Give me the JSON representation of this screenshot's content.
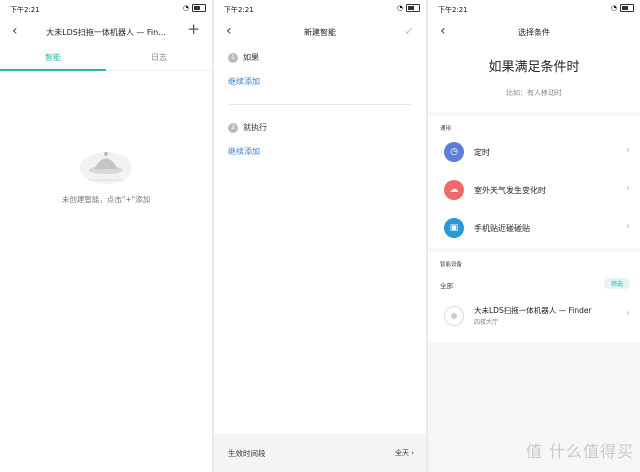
{
  "status": {
    "time": "下午2:21"
  },
  "screen1": {
    "title": "大未LDS扫拖一体机器人 — Fin...",
    "add_icon": "plus-icon",
    "tabs": [
      "智能",
      "日志"
    ],
    "empty_text": "未创建智能，点击\"+\"添加"
  },
  "screen2": {
    "title": "新建智能",
    "if_number": "1",
    "if_label": "如果",
    "if_add": "继续添加",
    "then_number": "2",
    "then_label": "就执行",
    "then_add": "继续添加",
    "footer_label": "生效时间段",
    "footer_value": "全天"
  },
  "screen3": {
    "title": "选择条件",
    "big_title": "如果满足条件时",
    "hint": "比如：有人移动时",
    "general_label": "通用",
    "general_items": [
      {
        "label": "定时",
        "icon": "clock-icon",
        "color": "#5b7fd9"
      },
      {
        "label": "室外天气发生变化时",
        "icon": "weather-icon",
        "color": "#ef6a6a"
      },
      {
        "label": "手机贴近碰碰贴",
        "icon": "nfc-icon",
        "color": "#2a97d6"
      }
    ],
    "device_label": "智能设备",
    "all_label": "全部",
    "filter_label": "筛选",
    "device": {
      "name": "大未LDS扫拖一体机器人 — Finder",
      "room": "四楼大厅"
    },
    "watermark": "值 什么值得买"
  },
  "colors": {
    "accent": "#2bb5a8",
    "link": "#3f7cc2"
  }
}
